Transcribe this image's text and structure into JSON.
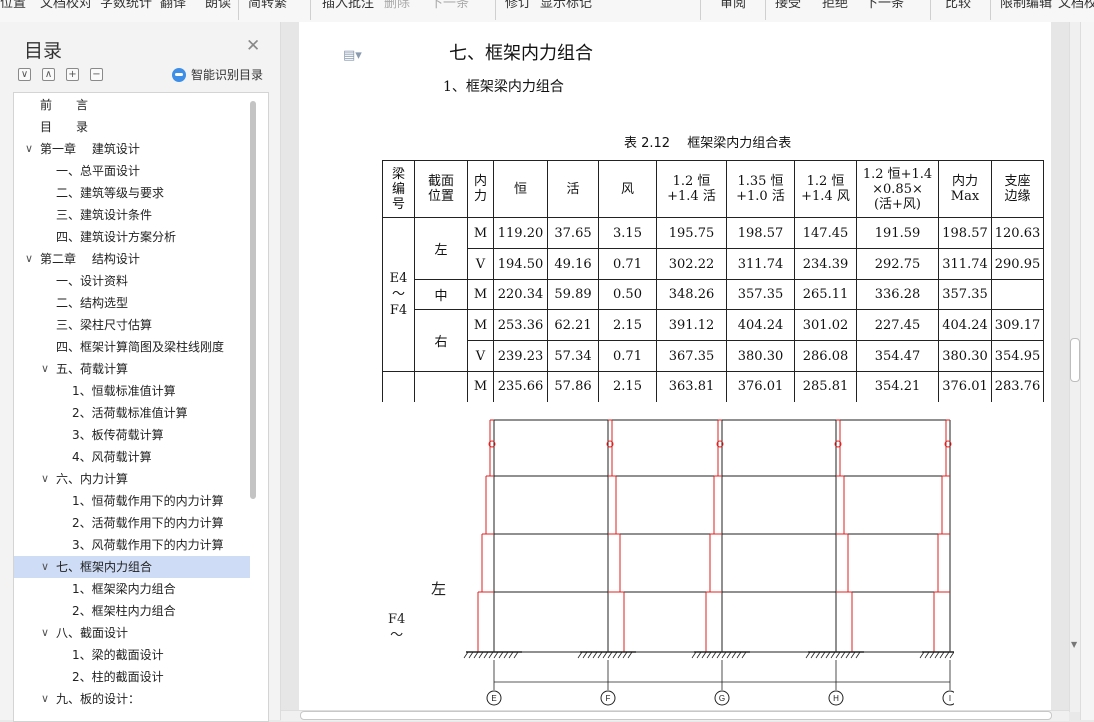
{
  "ribbon": {
    "items": [
      "位置",
      "文档校对",
      "字数统计",
      "翻译",
      "朗读",
      "简转繁",
      "插入批注",
      "删除",
      "下一条",
      "修订",
      "显示标记",
      "审阅",
      "接受",
      "拒绝",
      "下一条",
      "比较",
      "限制编辑",
      "文档校"
    ]
  },
  "toc": {
    "title": "目录",
    "smart_label": "智能识别目录",
    "items": [
      {
        "label": "前　　言",
        "level": 0,
        "arrow": ""
      },
      {
        "label": "目　　录",
        "level": 0,
        "arrow": ""
      },
      {
        "label": "第一章　 建筑设计",
        "level": 0,
        "arrow": "∨"
      },
      {
        "label": "一、总平面设计",
        "level": 1,
        "arrow": ""
      },
      {
        "label": "二、建筑等级与要求",
        "level": 1,
        "arrow": ""
      },
      {
        "label": "三、建筑设计条件",
        "level": 1,
        "arrow": ""
      },
      {
        "label": "四、建筑设计方案分析",
        "level": 1,
        "arrow": ""
      },
      {
        "label": "第二章　 结构设计",
        "level": 0,
        "arrow": "∨"
      },
      {
        "label": "一、设计资料",
        "level": 1,
        "arrow": ""
      },
      {
        "label": "二、结构选型",
        "level": 1,
        "arrow": ""
      },
      {
        "label": "三、梁柱尺寸估算",
        "level": 1,
        "arrow": ""
      },
      {
        "label": "四、框架计算简图及梁柱线刚度",
        "level": 1,
        "arrow": ""
      },
      {
        "label": "五、荷载计算",
        "level": 1,
        "arrow": "∨"
      },
      {
        "label": "1、恒载标准值计算",
        "level": 2,
        "arrow": ""
      },
      {
        "label": "2、活荷载标准值计算",
        "level": 2,
        "arrow": ""
      },
      {
        "label": "3、板传荷载计算",
        "level": 2,
        "arrow": ""
      },
      {
        "label": "4、风荷载计算",
        "level": 2,
        "arrow": ""
      },
      {
        "label": "六、内力计算",
        "level": 1,
        "arrow": "∨"
      },
      {
        "label": "1、恒荷载作用下的内力计算",
        "level": 2,
        "arrow": ""
      },
      {
        "label": "2、活荷载作用下的内力计算",
        "level": 2,
        "arrow": ""
      },
      {
        "label": "3、风荷载作用下的内力计算",
        "level": 2,
        "arrow": ""
      },
      {
        "label": "七、框架内力组合",
        "level": 1,
        "arrow": "∨",
        "selected": true
      },
      {
        "label": "1、框架梁内力组合",
        "level": 2,
        "arrow": ""
      },
      {
        "label": "2、框架柱内力组合",
        "level": 2,
        "arrow": ""
      },
      {
        "label": "八、截面设计",
        "level": 1,
        "arrow": "∨"
      },
      {
        "label": "1、梁的截面设计",
        "level": 2,
        "arrow": ""
      },
      {
        "label": "2、柱的截面设计",
        "level": 2,
        "arrow": ""
      },
      {
        "label": "九、板的设计：",
        "level": 1,
        "arrow": "∨"
      }
    ]
  },
  "doc": {
    "h1": "七、框架内力组合",
    "h2": "1、框架梁内力组合",
    "caption": "表 2.12　 框架梁内力组合表",
    "headers": [
      "梁\n编\n号",
      "截面\n位置",
      "内\n力",
      "恒",
      "活",
      "风",
      "1.2 恒\n+1.4 活",
      "1.35 恒\n+1.0 活",
      "1.2 恒\n+1.4 风",
      "1.2 恒+1.4\n×0.85×\n(活+风)",
      "内力\nMax",
      "支座\n边缘"
    ],
    "beam_id": "E4\n～\nF4",
    "rows": [
      {
        "pos": "左",
        "force": "M",
        "vals": [
          "119.20",
          "37.65",
          "3.15",
          "195.75",
          "198.57",
          "147.45",
          "191.59",
          "198.57",
          "120.63"
        ]
      },
      {
        "pos": "",
        "force": "V",
        "vals": [
          "194.50",
          "49.16",
          "0.71",
          "302.22",
          "311.74",
          "234.39",
          "292.75",
          "311.74",
          "290.95"
        ]
      },
      {
        "pos": "中",
        "force": "M",
        "vals": [
          "220.34",
          "59.89",
          "0.50",
          "348.26",
          "357.35",
          "265.11",
          "336.28",
          "357.35",
          ""
        ]
      },
      {
        "pos": "右",
        "force": "M",
        "vals": [
          "253.36",
          "62.21",
          "2.15",
          "391.12",
          "404.24",
          "301.02",
          "227.45",
          "404.24",
          "309.17"
        ]
      },
      {
        "pos": "",
        "force": "V",
        "vals": [
          "239.23",
          "57.34",
          "0.71",
          "367.35",
          "380.30",
          "286.08",
          "354.47",
          "380.30",
          "354.95"
        ]
      },
      {
        "pos": "",
        "force": "M",
        "vals": [
          "235.66",
          "57.86",
          "2.15",
          "363.81",
          "376.01",
          "285.81",
          "354.21",
          "376.01",
          "283.76"
        ]
      }
    ],
    "figure_left": "左",
    "figure_beam": "F4\n～",
    "axis_labels": [
      "E",
      "F",
      "G",
      "H",
      "I"
    ]
  }
}
